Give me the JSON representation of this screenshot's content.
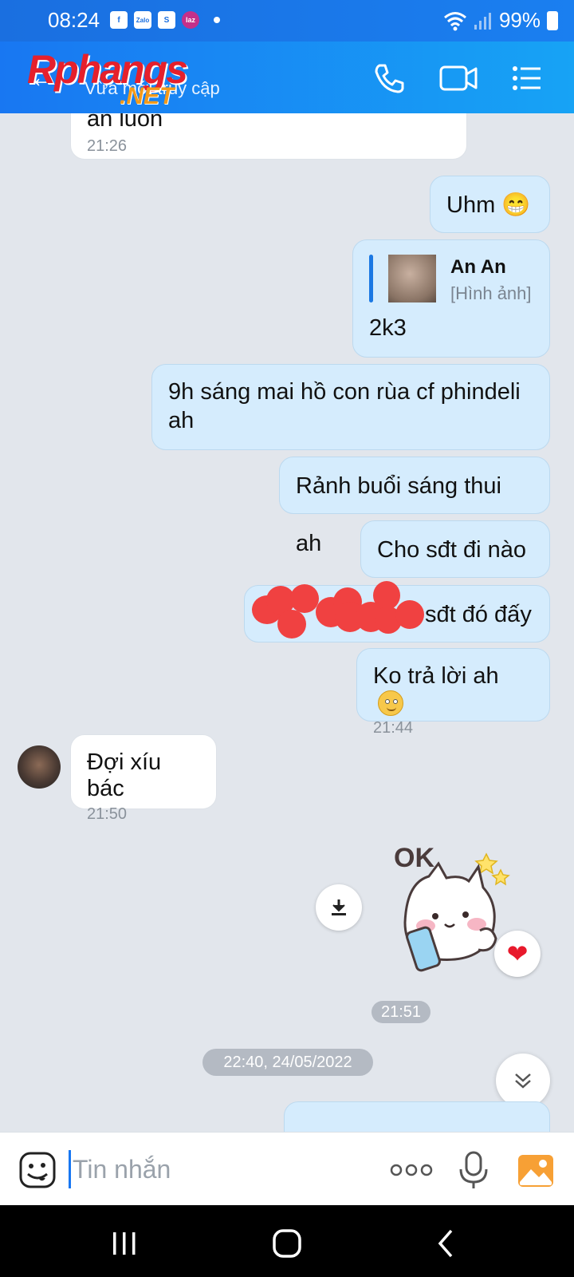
{
  "status_bar": {
    "time": "08:24",
    "apps": [
      "f",
      "Zalo",
      "S",
      "laz"
    ],
    "battery": "99%"
  },
  "header": {
    "watermark": "Rphangs",
    "watermark_suffix": ".NET",
    "status": "Vừa mới truy cập",
    "icons": [
      "back-arrow-icon",
      "phone-icon",
      "video-call-icon",
      "menu-list-icon"
    ]
  },
  "messages": [
    {
      "id": "m1",
      "dir": "in",
      "text": "an luôn",
      "time": "21:26"
    },
    {
      "id": "m2",
      "dir": "out",
      "text": "Uhm 😁"
    },
    {
      "id": "m3",
      "dir": "out",
      "quote_name": "An An",
      "quote_sub": "[Hình ảnh]",
      "text": "2k3"
    },
    {
      "id": "m4",
      "dir": "out",
      "text": "9h sáng mai hồ con rùa cf phindeli ah"
    },
    {
      "id": "m5",
      "dir": "out",
      "text": "Rảnh buổi sáng thui ah"
    },
    {
      "id": "m6",
      "dir": "out",
      "text": "Cho sđt đi nào"
    },
    {
      "id": "m7",
      "dir": "out",
      "text": "sđt đó đấy"
    },
    {
      "id": "m8",
      "dir": "out",
      "text": "Ko trả lời ah",
      "time": "21:44"
    },
    {
      "id": "m9",
      "dir": "in",
      "text": "Đợi xíu bác",
      "time": "21:50"
    }
  ],
  "sticker": {
    "text": "OK",
    "time": "21:51"
  },
  "date_separator": "22:40, 24/05/2022",
  "input": {
    "placeholder": "Tin nhắn"
  },
  "colors": {
    "accent": "#1877f2",
    "outgoing_bubble": "#d5ecfd",
    "incoming_bubble": "#ffffff",
    "redaction": "#f04141"
  }
}
